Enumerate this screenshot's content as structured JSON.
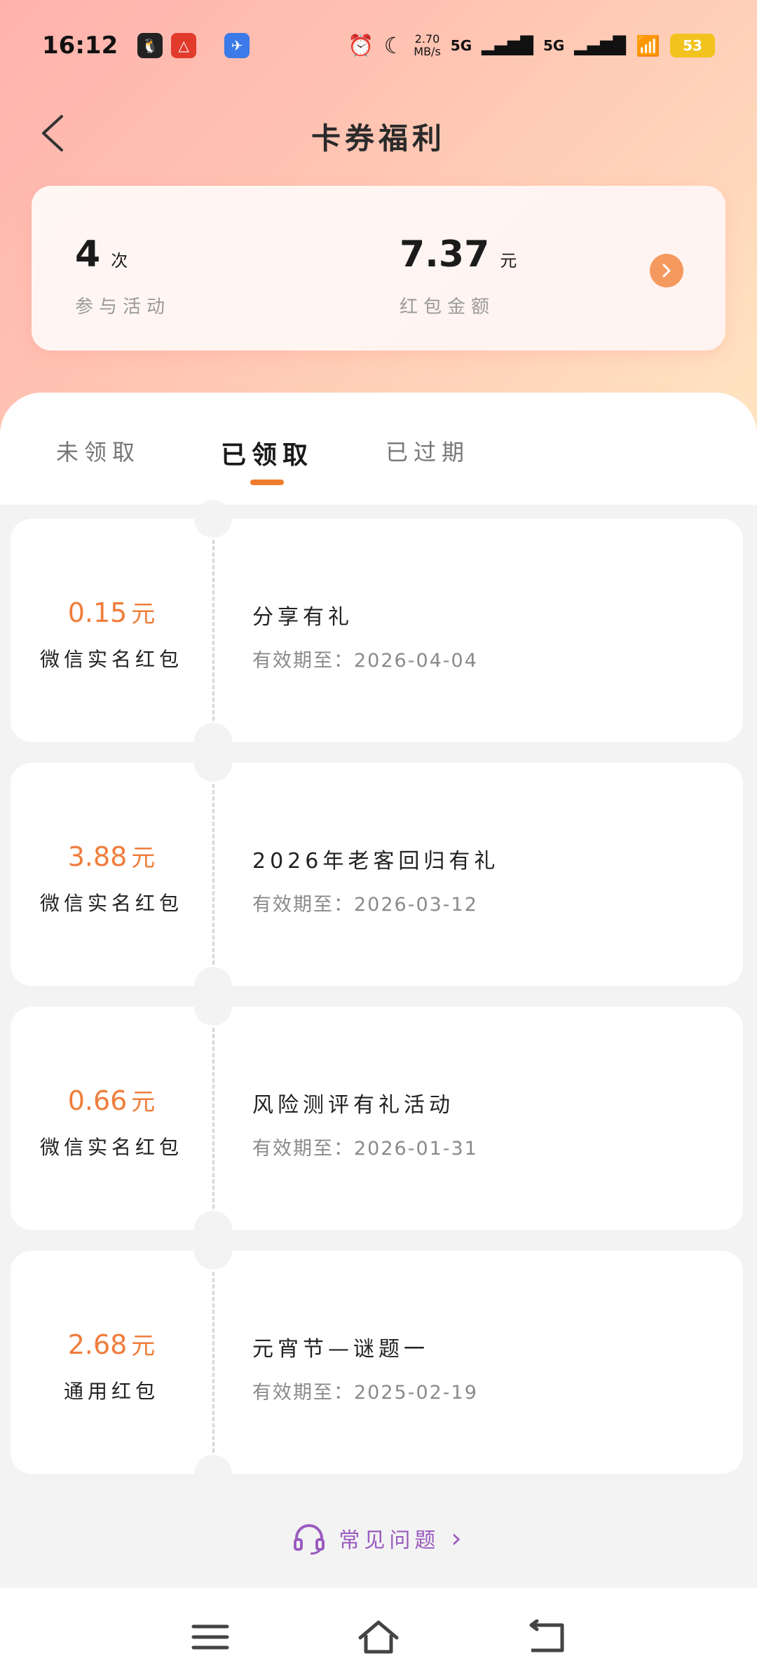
{
  "status_bar": {
    "time": "16:12",
    "net_speed": "2.70",
    "net_unit": "MB/s",
    "signal1": "5G",
    "signal2": "5G",
    "battery": "53"
  },
  "header": {
    "title": "卡券福利"
  },
  "summary": {
    "participation_count": "4",
    "participation_unit": "次",
    "participation_label": "参与活动",
    "redpacket_amount": "7.37",
    "redpacket_unit": "元",
    "redpacket_label": "红包金额"
  },
  "tabs": [
    {
      "label": "未领取"
    },
    {
      "label": "已领取"
    },
    {
      "label": "已过期"
    }
  ],
  "coupons": [
    {
      "amount": "0.15",
      "unit": "元",
      "type": "微信实名红包",
      "title": "分享有礼",
      "expiry": "有效期至：2026-04-04"
    },
    {
      "amount": "3.88",
      "unit": "元",
      "type": "微信实名红包",
      "title": "2026年老客回归有礼",
      "expiry": "有效期至：2026-03-12"
    },
    {
      "amount": "0.66",
      "unit": "元",
      "type": "微信实名红包",
      "title": "风险测评有礼活动",
      "expiry": "有效期至：2026-01-31"
    },
    {
      "amount": "2.68",
      "unit": "元",
      "type": "通用红包",
      "title": "元宵节—谜题一",
      "expiry": "有效期至：2025-02-19"
    }
  ],
  "faq": {
    "label": "常见问题",
    "chevron": "›"
  },
  "colors": {
    "accent": "#f07d3c",
    "faq": "#9a5bbd"
  }
}
